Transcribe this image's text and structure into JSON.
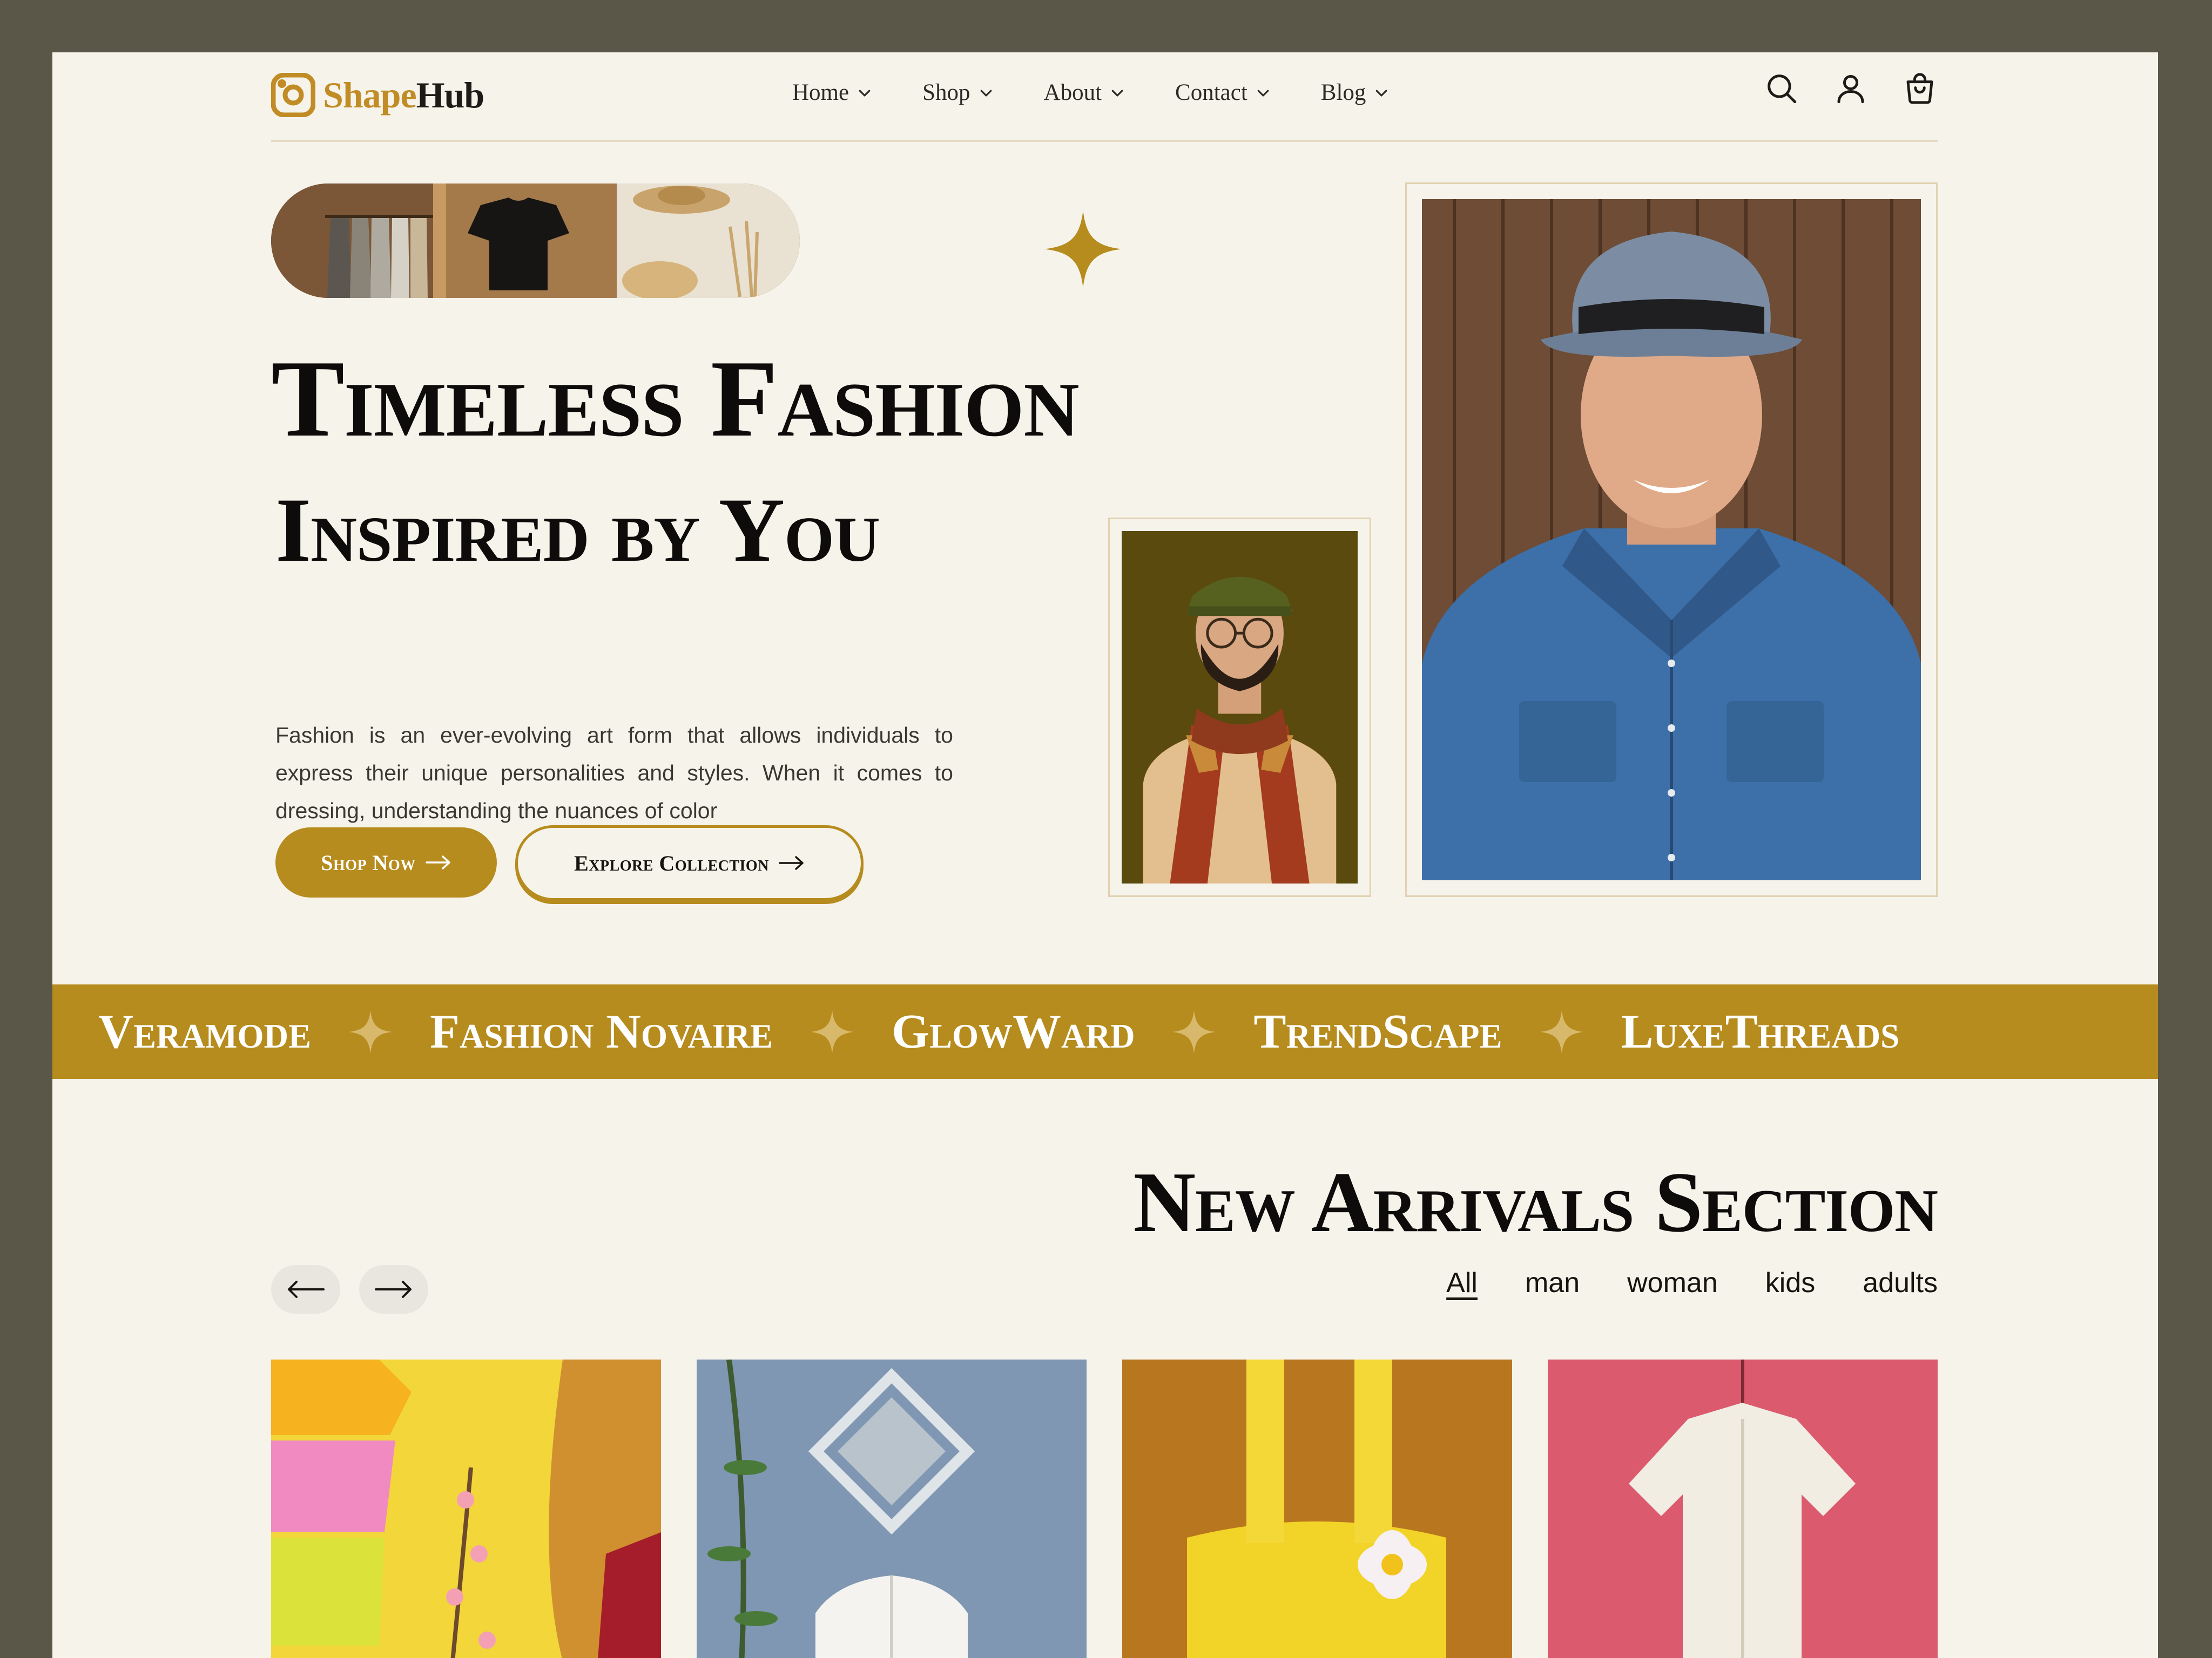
{
  "app": {
    "logo_part1": "Shape",
    "logo_part2": "Hub",
    "brand_color": "#b68c1e"
  },
  "nav": {
    "items": [
      {
        "label": "Home",
        "icon": "chevron-down-icon"
      },
      {
        "label": "Shop",
        "icon": "chevron-down-icon"
      },
      {
        "label": "About",
        "icon": "chevron-down-icon"
      },
      {
        "label": "Contact",
        "icon": "chevron-down-icon"
      },
      {
        "label": "Blog",
        "icon": "chevron-down-icon"
      }
    ],
    "icons": [
      "search-icon",
      "user-icon",
      "shopping-bag-icon"
    ]
  },
  "hero": {
    "title_line1": "Timeless Fashion",
    "title_line2": "Inspired by You",
    "description": "Fashion is an ever-evolving art form that allows individuals to express their unique personalities and styles. When it comes to dressing, understanding the nuances of color",
    "shop_button": "Shop Now",
    "explore_button": "Explore Collection"
  },
  "marquee": {
    "brands": [
      "Veramode",
      "Fashion Novaire",
      "GlowWard",
      "TrendScape",
      "LuxeThreads"
    ]
  },
  "arrivals": {
    "title": "New Arrivals Section",
    "filters": [
      {
        "label": "All",
        "active": true
      },
      {
        "label": "man",
        "active": false
      },
      {
        "label": "woman",
        "active": false
      },
      {
        "label": "kids",
        "active": false
      },
      {
        "label": "adults",
        "active": false
      }
    ]
  }
}
